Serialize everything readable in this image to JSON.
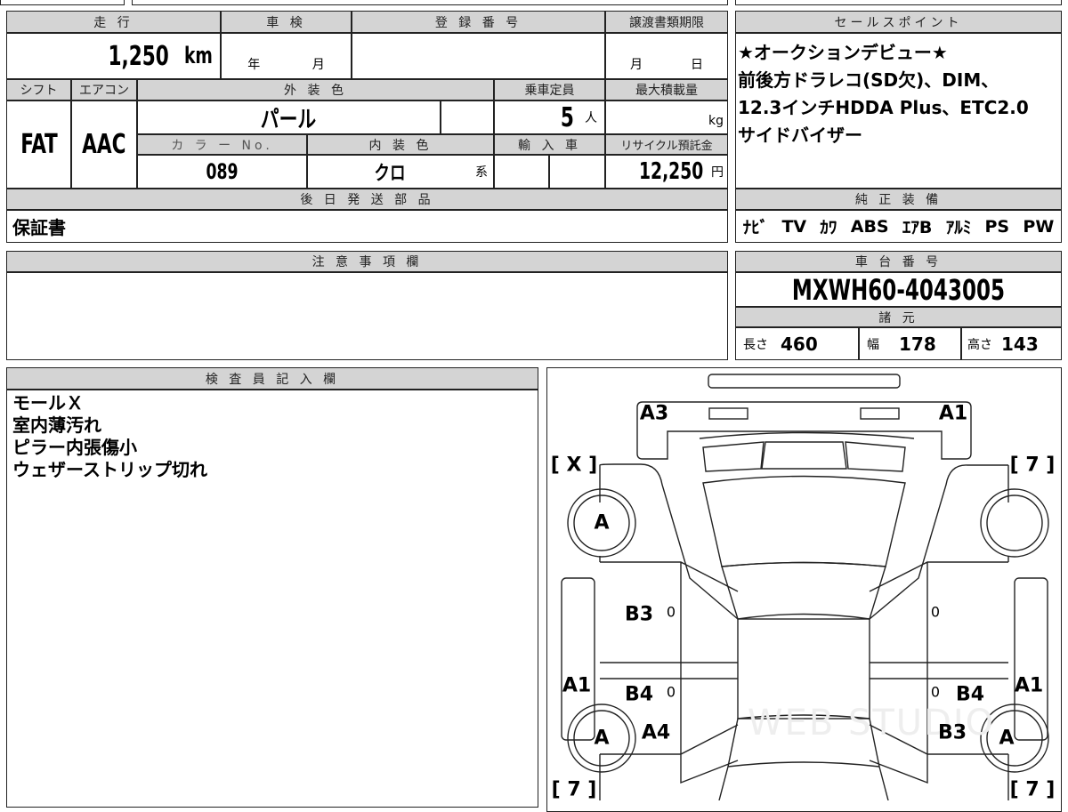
{
  "main": {
    "mileage_label": "走 行",
    "mileage": "1,250",
    "mileage_unit": "km",
    "inspection_label": "車 検",
    "inspection_year": "年",
    "inspection_month": "月",
    "registration_label": "登 録 番 号",
    "transfer_label": "譲渡書類期限",
    "transfer_month": "月",
    "transfer_day": "日",
    "shift_label": "シフト",
    "shift": "FAT",
    "ac_label": "エアコン",
    "ac": "AAC",
    "exterior_label": "外 装 色",
    "exterior": "パール",
    "capacity_label": "乗車定員",
    "capacity": "5",
    "capacity_unit": "人",
    "load_label": "最大積載量",
    "load_unit": "kg",
    "color_no_label": "カ ラ ー No.",
    "color_no": "089",
    "interior_label": "内 装 色",
    "interior": "クロ",
    "interior_suffix": "系",
    "import_label": "輸 入 車",
    "recycle_label": "リサイクル預託金",
    "recycle": "12,250",
    "recycle_unit": "円",
    "later_label": "後 日 発 送 部 品",
    "later": "保証書"
  },
  "sales": {
    "label": "セールスポイント",
    "lines": [
      "★オークションデビュー★",
      "前後方ドラレコ(SD欠)、DIM、",
      "12.3インチHDDA Plus、ETC2.0",
      "サイドバイザー"
    ]
  },
  "equipment": {
    "label": "純 正 装 備",
    "items": [
      "ﾅﾋﾞ",
      "TV",
      "ｶﾜ",
      "ABS",
      "ｴｱB",
      "ｱﾙﾐ",
      "PS",
      "PW"
    ]
  },
  "notes": {
    "label": "注 意 事 項 欄"
  },
  "chassis": {
    "label": "車 台 番 号",
    "value": "MXWH60-4043005",
    "spec_label": "諸 元",
    "length_label": "長さ",
    "length": "460",
    "width_label": "幅",
    "width": "178",
    "height_label": "高さ",
    "height": "143"
  },
  "inspector": {
    "label": "検 査 員 記 入 欄",
    "lines": [
      "モールＸ",
      "室内薄汚れ",
      "ピラー内張傷小",
      "ウェザーストリップ切れ"
    ]
  },
  "diagram": {
    "marks": [
      "A3",
      "A1",
      "[ X ]",
      "[ 7 ]",
      "A",
      "A",
      "A",
      "B3",
      "0",
      "0",
      "A1",
      "B4",
      "0",
      "0",
      "B4",
      "A1",
      "A4",
      "B3",
      "[ 7 ]",
      "[ 7 ]"
    ],
    "watermark": "WEB STUDIO"
  }
}
